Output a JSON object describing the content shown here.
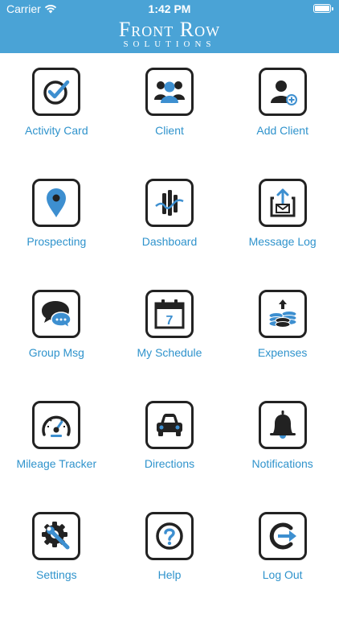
{
  "status_bar": {
    "carrier": "Carrier",
    "time": "1:42 PM"
  },
  "brand": {
    "title": "Front Row",
    "subtitle": "SOLUTIONS"
  },
  "colors": {
    "header": "#4aa3d6",
    "label": "#2f93cc",
    "icon_dark": "#222222",
    "icon_accent": "#3d8fd0"
  },
  "menu": [
    {
      "label": "Activity Card",
      "icon": "check-circle-icon"
    },
    {
      "label": "Client",
      "icon": "users-icon"
    },
    {
      "label": "Add Client",
      "icon": "add-user-icon"
    },
    {
      "label": "Prospecting",
      "icon": "map-pin-icon"
    },
    {
      "label": "Dashboard",
      "icon": "dashboard-chart-icon"
    },
    {
      "label": "Message Log",
      "icon": "message-log-icon"
    },
    {
      "label": "Group Msg",
      "icon": "chat-bubbles-icon"
    },
    {
      "label": "My Schedule",
      "icon": "calendar-icon"
    },
    {
      "label": "Expenses",
      "icon": "coins-icon"
    },
    {
      "label": "Mileage Tracker",
      "icon": "speedometer-icon"
    },
    {
      "label": "Directions",
      "icon": "car-icon"
    },
    {
      "label": "Notifications",
      "icon": "bell-icon"
    },
    {
      "label": "Settings",
      "icon": "settings-gear-icon"
    },
    {
      "label": "Help",
      "icon": "help-icon"
    },
    {
      "label": "Log Out",
      "icon": "logout-icon"
    }
  ],
  "calendar_day": "7"
}
